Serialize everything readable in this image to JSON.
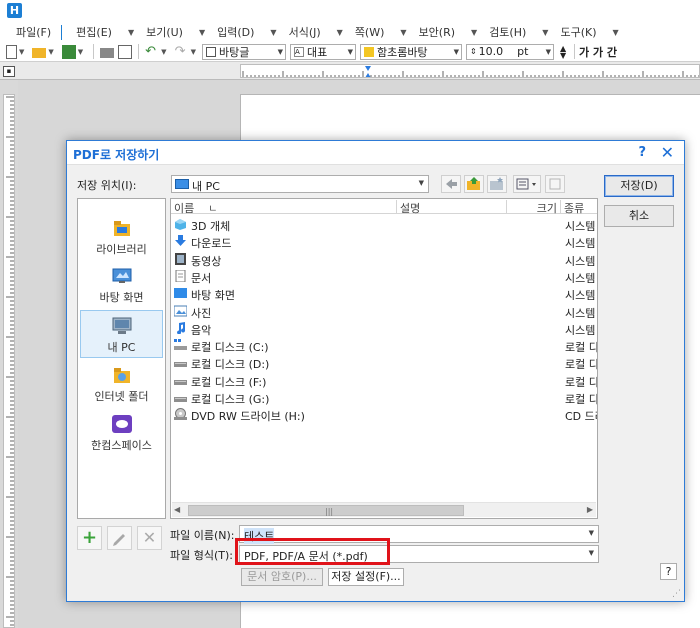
{
  "app": {
    "logo": "H"
  },
  "menu": [
    {
      "label": "파일(F)"
    },
    {
      "label": "편집(E)"
    },
    {
      "label": "보기(U)"
    },
    {
      "label": "입력(D)"
    },
    {
      "label": "서식(J)"
    },
    {
      "label": "쪽(W)"
    },
    {
      "label": "보안(R)"
    },
    {
      "label": "검토(H)"
    },
    {
      "label": "도구(K)"
    }
  ],
  "toolbar": {
    "style": "바탕글",
    "font_lang": "대표",
    "font": "함초롬바탕",
    "size": "10.0",
    "unit": "pt",
    "tail": "가 가 간"
  },
  "dialog": {
    "title": "PDF로 저장하기",
    "help": "?",
    "close": "✕",
    "location_label": "저장 위치(I):",
    "location_value": "내 PC",
    "save_button": "저장(D)",
    "cancel_button": "취소",
    "places": [
      {
        "label": "라이브러리"
      },
      {
        "label": "바탕 화면"
      },
      {
        "label": "내 PC"
      },
      {
        "label": "인터넷 폴더"
      },
      {
        "label": "한컴스페이스"
      }
    ],
    "columns": {
      "name": "이름",
      "sort": "ㄴ",
      "desc": "설명",
      "size": "크기",
      "type": "종류"
    },
    "files": [
      {
        "name": "3D 개체",
        "type": "시스템",
        "icon": "3d-objects-icon"
      },
      {
        "name": "다운로드",
        "type": "시스템",
        "icon": "download-icon"
      },
      {
        "name": "동영상",
        "type": "시스템",
        "icon": "video-icon"
      },
      {
        "name": "문서",
        "type": "시스템",
        "icon": "document-icon"
      },
      {
        "name": "바탕 화면",
        "type": "시스템",
        "icon": "desktop-icon"
      },
      {
        "name": "사진",
        "type": "시스템",
        "icon": "pictures-icon"
      },
      {
        "name": "음악",
        "type": "시스템",
        "icon": "music-icon"
      },
      {
        "name": "로컬 디스크 (C:)",
        "type": "로컬 디",
        "icon": "windows-drive-icon"
      },
      {
        "name": "로컬 디스크 (D:)",
        "type": "로컬 디",
        "icon": "drive-icon"
      },
      {
        "name": "로컬 디스크 (F:)",
        "type": "로컬 디",
        "icon": "drive-icon"
      },
      {
        "name": "로컬 디스크 (G:)",
        "type": "로컬 디",
        "icon": "drive-icon"
      },
      {
        "name": "DVD RW 드라이브 (H:)",
        "type": "CD 드라",
        "icon": "dvd-drive-icon"
      }
    ],
    "filename_label": "파일 이름(N):",
    "filename_value": "테스트",
    "filetype_label": "파일 형식(T):",
    "filetype_value": "PDF, PDF/A 문서 (*.pdf)",
    "doc_password_button": "문서 암호(P)...",
    "save_settings_button": "저장 설정(F)...",
    "question_button": "?"
  }
}
